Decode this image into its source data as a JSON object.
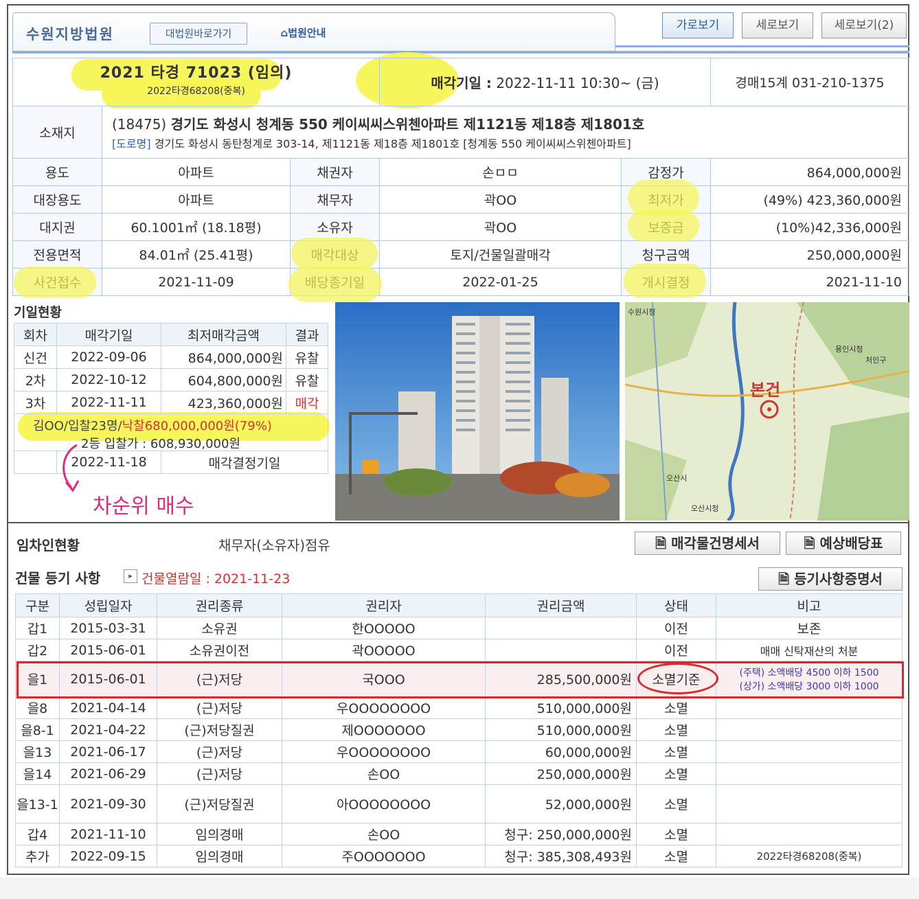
{
  "header": {
    "court_name": "수원지방법원",
    "supreme_court_button": "대법원바로가기",
    "court_help_button": "법원안내",
    "view_horizontal": "가로보기",
    "view_vertical": "세로보기",
    "view_vertical2": "세로보기(2)"
  },
  "case": {
    "number": "2021 타경 71023 (임의)",
    "duplicate": "2022타경68208(중복)",
    "sale_date_label": "매각기일 :",
    "sale_date": "2022-11-11 10:30~ (금)",
    "department": "경매15계 031-210-1375",
    "location_label": "소재지",
    "postal": "(18475)",
    "address": "경기도 화성시 청계동 550 케이씨씨스위첸아파트 제1121동 제18층 제1801호",
    "road_label": "[도로명]",
    "road_address": "경기도 화성시 동탄청계로 303-14, 제1121동 제18층 제1801호 [청계동 550 케이씨씨스위첸아파트]",
    "rows": [
      [
        "용도",
        "아파트",
        "채권자",
        "손ㅁㅁ",
        "감정가",
        "864,000,000원"
      ],
      [
        "대장용도",
        "아파트",
        "채무자",
        "곽OO",
        "최저가",
        "(49%) 423,360,000원"
      ],
      [
        "대지권",
        "60.1001㎡ (18.18평)",
        "소유자",
        "곽OO",
        "보증금",
        "(10%)42,336,000원"
      ],
      [
        "전용면적",
        "84.01㎡ (25.41평)",
        "매각대상",
        "토지/건물일괄매각",
        "청구금액",
        "250,000,000원"
      ],
      [
        "사건접수",
        "2021-11-09",
        "배당종기일",
        "2022-01-25",
        "개시결정",
        "2021-11-10"
      ]
    ]
  },
  "schedule": {
    "title": "기일현황",
    "headers": [
      "회차",
      "매각기일",
      "최저매각금액",
      "결과"
    ],
    "rows": [
      [
        "신건",
        "2022-09-06",
        "864,000,000원",
        "유찰"
      ],
      [
        "2차",
        "2022-10-12",
        "604,800,000원",
        "유찰"
      ],
      [
        "3차",
        "2022-11-11",
        "423,360,000원",
        "매각"
      ]
    ],
    "bid_prefix": "김OO/입찰23명/",
    "bid_winner": "낙찰680,000,000원(79%)",
    "second_bid": "2등 입찰가 : 608,930,000원",
    "decision_date": "2022-11-18",
    "decision_label": "매각결정기일",
    "annotation": "차순위 매수"
  },
  "map": {
    "label_main": "본건",
    "labels": [
      "수원시청",
      "용인시청",
      "오산시",
      "오산시청",
      "처인구"
    ]
  },
  "tenants": {
    "label": "임차인현황",
    "occupancy": "채무자(소유자)점유",
    "btn_sale_doc": "매각물건명세서",
    "btn_dividend": "예상배당표"
  },
  "registry": {
    "title": "건물 등기 사항",
    "view_date": "건물열람일 : 2021-11-23",
    "btn_cert": "등기사항증명서",
    "headers": [
      "구분",
      "성립일자",
      "권리종류",
      "권리자",
      "권리금액",
      "상태",
      "비고"
    ],
    "rows": [
      [
        "갑1",
        "2015-03-31",
        "소유권",
        "한OOOOO",
        "",
        "이전",
        "보존"
      ],
      [
        "갑2",
        "2015-06-01",
        "소유권이전",
        "곽OOOOO",
        "",
        "이전",
        "매매 신탁재산의 처분"
      ],
      [
        "을1",
        "2015-06-01",
        "(근)저당",
        "국OOO",
        "285,500,000원",
        "소멸기준",
        ""
      ],
      [
        "을8",
        "2021-04-14",
        "(근)저당",
        "우OOOOOOOO",
        "510,000,000원",
        "소멸",
        ""
      ],
      [
        "을8-1",
        "2021-04-22",
        "(근)저당질권",
        "제OOOOOOO",
        "510,000,000원",
        "소멸",
        ""
      ],
      [
        "을13",
        "2021-06-17",
        "(근)저당",
        "우OOOOOOOO",
        "60,000,000원",
        "소멸",
        ""
      ],
      [
        "을14",
        "2021-06-29",
        "(근)저당",
        "손OO",
        "250,000,000원",
        "소멸",
        ""
      ],
      [
        "을13-1",
        "2021-09-30",
        "(근)저당질권",
        "아OOOOOOOO",
        "52,000,000원",
        "소멸",
        ""
      ],
      [
        "갑4",
        "2021-11-10",
        "임의경매",
        "손OO",
        "청구: 250,000,000원",
        "소멸",
        ""
      ],
      [
        "추가",
        "2022-09-15",
        "임의경매",
        "주OOOOOOO",
        "청구: 385,308,493원",
        "소멸",
        "2022타경68208(중복)"
      ]
    ],
    "note_house": "(주택) 소액배당 4500 이하 1500",
    "note_store": "(상가) 소액배당 3000 이하 1000"
  },
  "colors": {
    "highlight": "#f7f554",
    "red": "#d2332f",
    "blue": "#2a61b8",
    "green": "#1f8a2a",
    "pink": "#e02a7d"
  }
}
